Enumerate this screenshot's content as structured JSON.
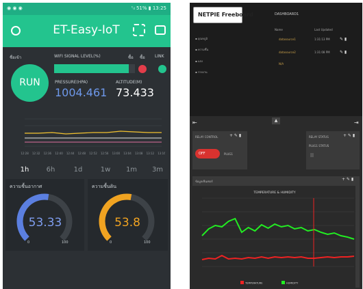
{
  "phone": {
    "status_bar": {
      "left_icons": "◉ ◉ ◉",
      "right_text": "ᵗᵢₗ 51% ▮ 13:25"
    },
    "app_title": "ET-Easy-IoT",
    "run_label": "RUN",
    "signal_label": "ชื่อเข้า",
    "wifi_label": "WIFI SIGNAL LEVEL(%)",
    "wifi_level": 0.92,
    "col_labels": [
      "ซื้อ",
      "ซื้อ"
    ],
    "link_label": "LINK",
    "pressure_label": "PRESSURE(HPA)",
    "pressure_value": "1004.461",
    "altitude_label": "ALTITUDE(M)",
    "altitude_value": "73.433",
    "timeframes": [
      "1h",
      "6h",
      "1d",
      "1w",
      "1m",
      "3m"
    ],
    "gauge1": {
      "label": "ความชื้นอากาศ",
      "value": "53.33",
      "min": "0",
      "max": "100",
      "fraction": 0.5333,
      "color": "#5b7fe0"
    },
    "gauge2": {
      "label": "ความชื้นดิน",
      "value": "53.8",
      "min": "0",
      "max": "100",
      "fraction": 0.538,
      "color": "#f0a321"
    },
    "graph_times": [
      "12:28",
      "12:32",
      "12:36",
      "12:40",
      "12:44",
      "12:48",
      "12:52",
      "12:56",
      "13:00",
      "13:04",
      "13:08",
      "13:12",
      "13:16"
    ]
  },
  "freeboard": {
    "logo": "NETPIE Freeboard",
    "title": "DASHBOARD1",
    "left_links": [
      "▪ อุณหภูมิ",
      "▪ ความชื้น",
      "▪ แสง",
      "▪ รายงาน"
    ],
    "table_header": [
      "Name",
      "Last Updated"
    ],
    "rows": [
      {
        "name": "datasource1",
        "time": "1:31:13 PM"
      },
      {
        "name": "datasource2",
        "time": "1:31:08 PM"
      },
      {
        "name": "N/A",
        "time": ""
      }
    ],
    "relay_pane_title": "RELAY CONTROL",
    "switch_text": "OFF",
    "switch_label": "PLUG1",
    "right_pane_title": "RELAY STATUS",
    "right_pane_sub": "PLUG1 STATUS",
    "chart_pane_title": "ข้อมูลเซ็นเซอร์",
    "chart_title": "TEMPERATURE & HUMIDITY",
    "legend": [
      "TEMPERATURE",
      "HUMIDITY"
    ]
  },
  "chart_data": {
    "type": "line",
    "title": "TEMPERATURE & HUMIDITY",
    "xlabel": "",
    "ylabel": "",
    "x": [
      0,
      1,
      2,
      3,
      4,
      5,
      6,
      7,
      8,
      9,
      10,
      11,
      12,
      13,
      14,
      15,
      16,
      17,
      18,
      19,
      20,
      21,
      22,
      23
    ],
    "series": [
      {
        "name": "TEMPERATURE",
        "color": "#ee2222",
        "values": [
          10,
          12,
          11,
          16,
          11,
          12,
          11,
          13,
          12,
          14,
          12,
          14,
          13,
          14,
          13,
          14,
          12,
          12,
          13,
          14,
          13,
          14,
          14,
          15
        ]
      },
      {
        "name": "HUMIDITY",
        "color": "#22ee22",
        "values": [
          45,
          55,
          60,
          58,
          66,
          70,
          50,
          57,
          52,
          61,
          56,
          62,
          58,
          60,
          55,
          57,
          52,
          54,
          50,
          47,
          49,
          45,
          43,
          40
        ]
      }
    ],
    "ylim": [
      0,
      100
    ]
  }
}
